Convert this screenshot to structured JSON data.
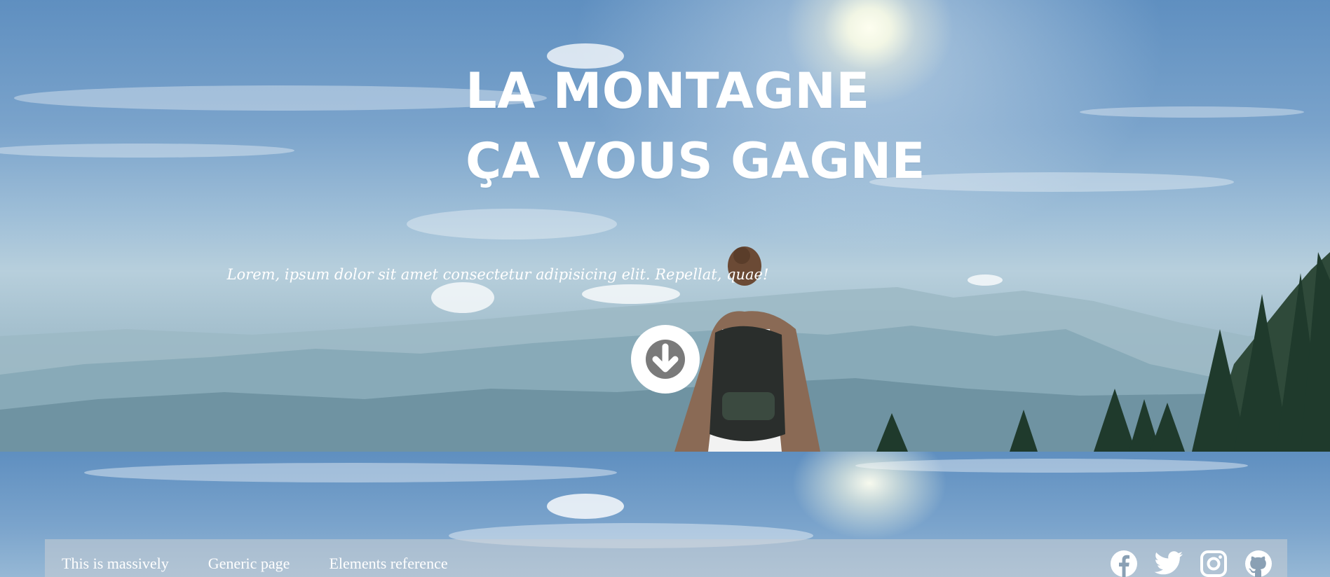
{
  "hero": {
    "title_line1": "LA MONTAGNE",
    "title_line2": "ÇA VOUS GAGNE",
    "subtitle": "Lorem, ipsum dolor sit amet consectetur adipisicing elit. Repellat, quae!",
    "scroll_icon": "arrow-down-circle-icon"
  },
  "nav": {
    "links": [
      {
        "label": "This is massively"
      },
      {
        "label": "Generic page"
      },
      {
        "label": "Elements reference"
      }
    ],
    "social_icons": [
      "facebook-icon",
      "twitter-icon",
      "instagram-icon",
      "github-icon"
    ]
  },
  "colors": {
    "text": "#ffffff",
    "sky": "#6c98c4",
    "nav_bg": "rgba(200,205,212,0.55)"
  }
}
